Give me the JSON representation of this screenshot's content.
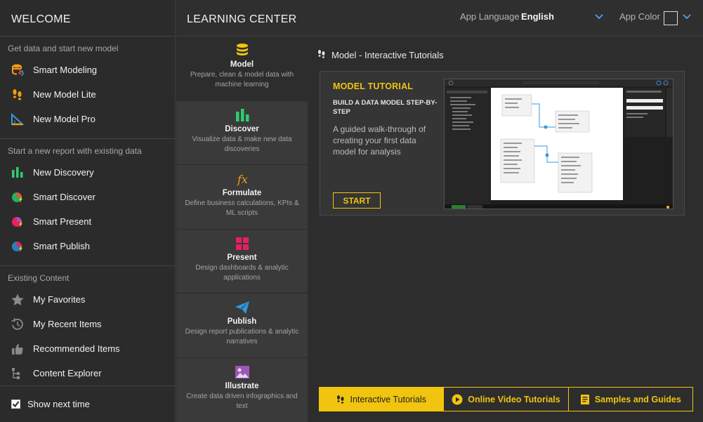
{
  "sidebar": {
    "title": "WELCOME",
    "sections": [
      {
        "title": "Get data and start new model",
        "items": [
          {
            "label": "Smart Modeling",
            "icon": "smart-modeling-icon"
          },
          {
            "label": "New Model Lite",
            "icon": "footprints-icon"
          },
          {
            "label": "New Model Pro",
            "icon": "ruler-triangle-icon"
          }
        ]
      },
      {
        "title": "Start a new report with existing data",
        "items": [
          {
            "label": "New Discovery",
            "icon": "bar-chart-icon"
          },
          {
            "label": "Smart Discover",
            "icon": "pie-bolt-icon"
          },
          {
            "label": "Smart Present",
            "icon": "pie-bolt-pink-icon"
          },
          {
            "label": "Smart Publish",
            "icon": "pie-bolt-blue-icon"
          }
        ]
      },
      {
        "title": "Existing Content",
        "items": [
          {
            "label": "My Favorites",
            "icon": "star-icon"
          },
          {
            "label": "My Recent Items",
            "icon": "history-icon"
          },
          {
            "label": "Recommended Items",
            "icon": "thumbs-up-icon"
          },
          {
            "label": "Content Explorer",
            "icon": "tree-icon"
          }
        ]
      }
    ],
    "footer": {
      "label": "Show next time",
      "checked": true
    }
  },
  "header": {
    "title": "LEARNING CENTER",
    "language_label": "App Language",
    "language_value": "English",
    "color_label": "App Color"
  },
  "categories": [
    {
      "name": "Model",
      "desc": "Prepare, clean & model data with machine learning",
      "icon": "database-icon",
      "active": true
    },
    {
      "name": "Discover",
      "desc": "Visualize data & make new data discoveries",
      "icon": "bar-chart-icon",
      "active": false
    },
    {
      "name": "Formulate",
      "desc": "Define business calculations, KPIs & ML scripts",
      "icon": "fx-icon",
      "active": false
    },
    {
      "name": "Present",
      "desc": "Design dashboards & analytic applications",
      "icon": "grid-icon",
      "active": false
    },
    {
      "name": "Publish",
      "desc": "Design report publications & analytic narratives",
      "icon": "paper-plane-icon",
      "active": false
    },
    {
      "name": "Illustrate",
      "desc": "Create data driven infographics and text",
      "icon": "image-icon",
      "active": false
    }
  ],
  "main": {
    "section_title": "Model - Interactive Tutorials",
    "card": {
      "title": "MODEL TUTORIAL",
      "subtitle": "BUILD A DATA MODEL STEP-BY-STEP",
      "description": "A guided walk-through of creating your first data model for analysis",
      "button": "START"
    },
    "tabs": [
      {
        "label": "Interactive Tutorials",
        "icon": "footprints-icon",
        "active": true
      },
      {
        "label": "Online Video Tutorials",
        "icon": "play-circle-icon",
        "active": false
      },
      {
        "label": "Samples and Guides",
        "icon": "book-icon",
        "active": false
      }
    ]
  },
  "colors": {
    "accent": "#f1c40f",
    "background": "#2d2d2d",
    "panel": "#3a3a3a"
  }
}
